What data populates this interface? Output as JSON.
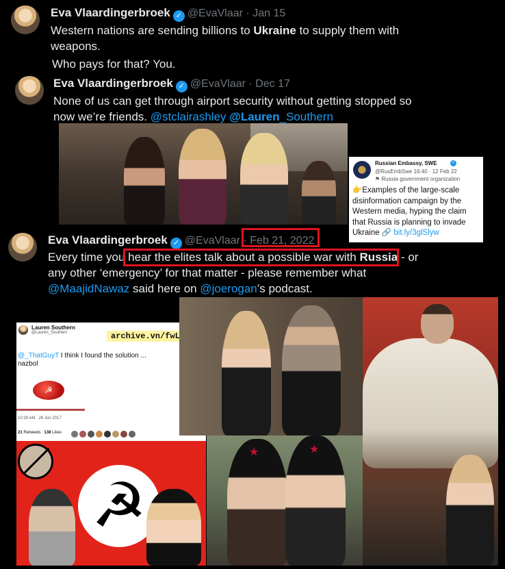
{
  "tweet1": {
    "name": "Eva Vlaardingerbroek",
    "handle": "@EvaVlaar",
    "date": "Jan 15",
    "line1_a": "Western nations are sending billions to ",
    "line1_b": "Ukraine",
    "line1_c": " to supply them with",
    "line2": "weapons.",
    "line3": "Who pays for that? You."
  },
  "tweet2": {
    "name": "Eva Vlaardingerbroek",
    "handle": "@EvaVlaar",
    "date": "Dec 17",
    "line1": "None of us can get through airport security without getting stopped so",
    "line2_a": "now we’re friends. ",
    "mention1": "@stclairashley",
    "mention2_bold": "@Lauren",
    "mention2_rest": "_Southern"
  },
  "embassy": {
    "name": "Russian Embassy, SWE",
    "handle": "@RusEmbSwe",
    "time": "16:40 · 12 Feb 22",
    "org": "Russia government organization",
    "body": "Examples of the large-scale disinformation campaign by the Western media, hyping the claim that Russia is planning to invade Ukraine",
    "link": "bit.ly/3glSlyw"
  },
  "tweet3": {
    "name": "Eva Vlaardingerbroek",
    "handle": "@EvaVlaar",
    "date": "Feb 21, 2022",
    "l1_a": "Every time you ",
    "l1_b": "hear the elites talk about a possible war with ",
    "l1_c": "Russia",
    "l1_d": " - or",
    "l2": "any other ‘emergency’ for that matter - please remember what",
    "l3_mention": "@MaajidNawaz",
    "l3_mid": " said here on ",
    "l3_mention2": "@joerogan",
    "l3_end": "’s podcast."
  },
  "lauren_card": {
    "name": "Lauren Southern",
    "handle": "@Lauren_Southern",
    "archive": "archive.vn/fwLgR",
    "reply_mention": "@_ThatGuyT",
    "reply_text": " I think I found the solution ...",
    "word": "nazbol",
    "timestamp": "10:29 AM · 26 Jun 2017",
    "retweets_num": "21",
    "retweets_label": "Retweets",
    "likes_num": "138",
    "likes_label": "Likes"
  },
  "colors": {
    "accent": "#1d9bf0",
    "highlight": "#e0131d",
    "flag_red": "#e2231a"
  }
}
